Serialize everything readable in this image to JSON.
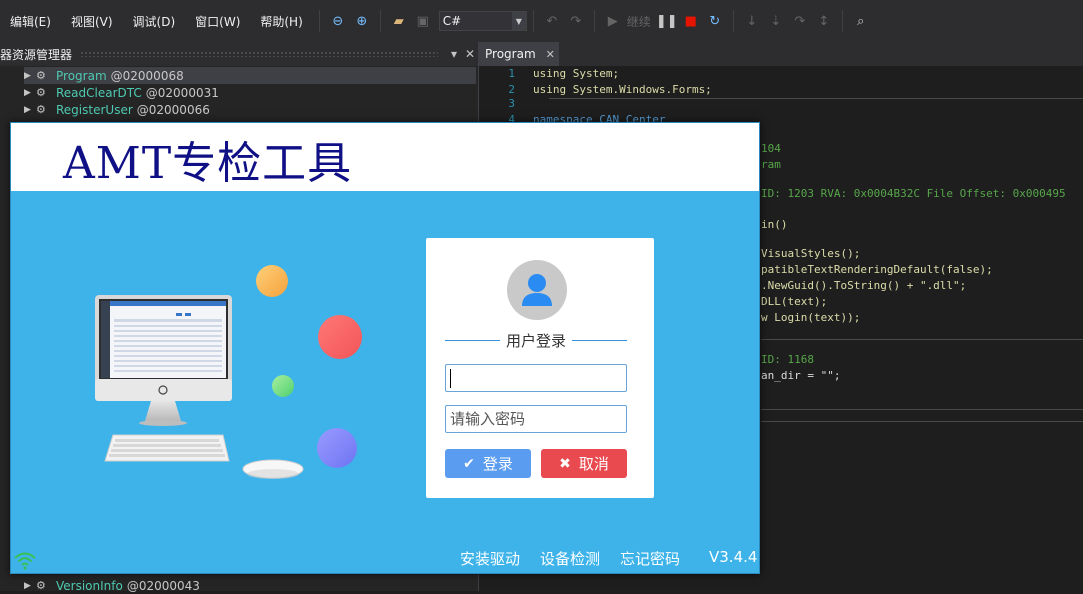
{
  "ide": {
    "menu": [
      "编辑(E)",
      "视图(V)",
      "调试(D)",
      "窗口(W)",
      "帮助(H)"
    ],
    "language": "C#",
    "continue_label": "继续",
    "colors": {
      "background": "#1e1e1e",
      "panel": "#252526",
      "menubar": "#2d2d30"
    }
  },
  "solution_explorer": {
    "title": "器资源管理器",
    "items": [
      {
        "name": "Program",
        "token": "@02000068"
      },
      {
        "name": "ReadClearDTC",
        "token": "@02000031"
      },
      {
        "name": "RegisterUser",
        "token": "@02000066"
      },
      {
        "name": "VersionInfo",
        "token": "@02000043"
      }
    ]
  },
  "editor": {
    "tab": "Program",
    "lines": [
      {
        "n": "1",
        "code": "using System;"
      },
      {
        "n": "2",
        "code": "using System.Windows.Forms;"
      },
      {
        "n": "3",
        "code": ""
      },
      {
        "n": "4",
        "code": "namespace CAN_Center"
      }
    ],
    "fragments": [
      "104",
      "ram",
      "ID: 1203 RVA: 0x0004B32C File Offset: 0x000495",
      "in()",
      "VisualStyles();",
      "patibleTextRenderingDefault(false);",
      ".NewGuid().ToString() + \".dll\";",
      "DLL(text);",
      "w Login(text));",
      "ID: 1168",
      "an_dir = \"\";"
    ]
  },
  "dialog": {
    "title": "AMT专检工具",
    "login_title": "用户登录",
    "username_value": "",
    "password_placeholder": "请输入密码",
    "login_button": "登录",
    "cancel_button": "取消",
    "footer_links": [
      "安装驱动",
      "设备检测",
      "忘记密码"
    ],
    "version": "V3.4.4",
    "colors": {
      "background": "#3db3ea",
      "title": "#0f0f86",
      "login_button": "#5a9cef",
      "cancel_button": "#e84a4f"
    }
  }
}
